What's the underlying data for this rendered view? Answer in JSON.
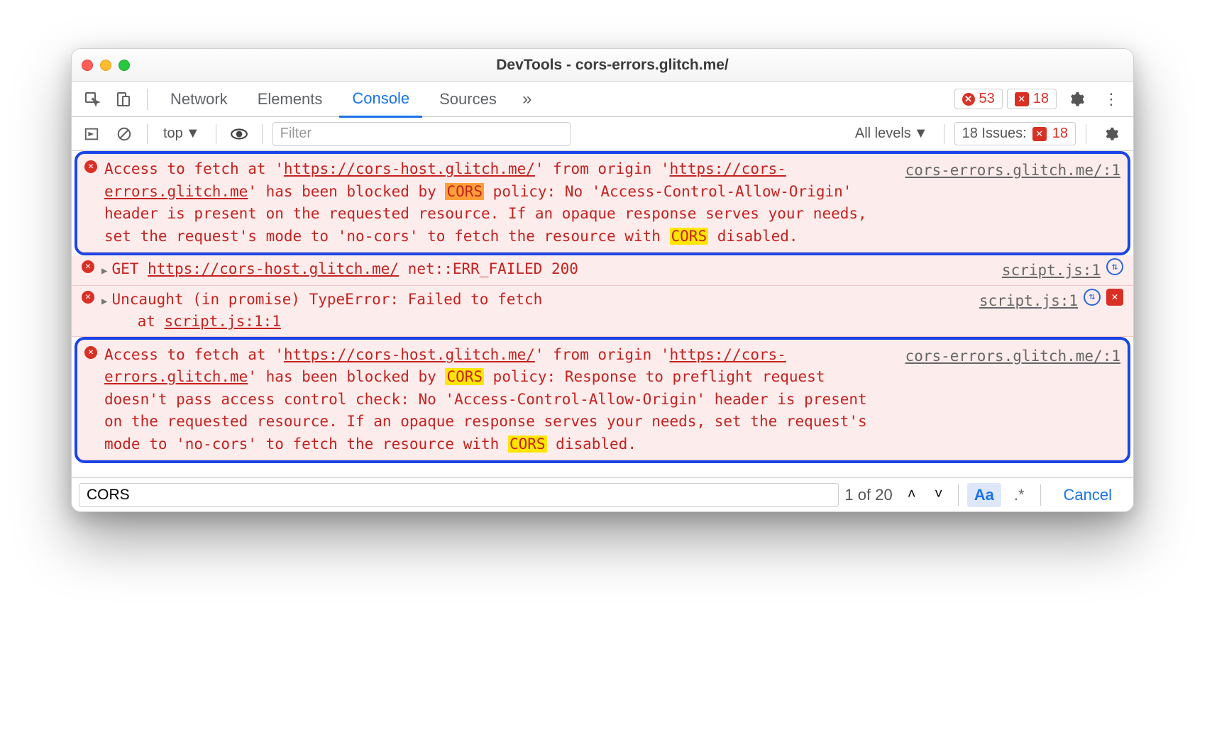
{
  "window": {
    "title": "DevTools - cors-errors.glitch.me/"
  },
  "tabs": {
    "items": [
      "Network",
      "Elements",
      "Console",
      "Sources"
    ],
    "active": "Console",
    "error_count": "53",
    "issue_count": "18"
  },
  "toolbar": {
    "context": "top",
    "filter_placeholder": "Filter",
    "levels": "All levels",
    "issues_label": "18 Issues:",
    "issues_count": "18"
  },
  "entries": [
    {
      "source": "cors-errors.glitch.me/:1",
      "parts": {
        "p1": "Access to fetch at '",
        "url1": "https://cors-host.glitch.me/",
        "p2": "' from origin '",
        "url2": "https://cors-errors.glitch.me",
        "p3": "' has been blocked by ",
        "cors1": "CORS",
        "p4": " policy: No 'Access-Control-Allow-Origin' header is present on the requested resource. If an opaque response serves your needs, set the request's mode to 'no-cors' to fetch the resource with ",
        "cors2": "CORS",
        "p5": " disabled."
      }
    },
    {
      "source": "script.js:1",
      "parts": {
        "p1": "GET ",
        "url1": "https://cors-host.glitch.me/",
        "p2": " net::ERR_FAILED 200"
      }
    },
    {
      "source": "script.js:1",
      "parts": {
        "p1": "Uncaught (in promise) TypeError: Failed to fetch",
        "p2": "    at ",
        "url1": "script.js:1:1"
      }
    },
    {
      "source": "cors-errors.glitch.me/:1",
      "parts": {
        "p1": "Access to fetch at '",
        "url1": "https://cors-host.glitch.me/",
        "p2": "' from origin '",
        "url2": "https://cors-errors.glitch.me",
        "p3": "' has been blocked by ",
        "cors1": "CORS",
        "p4": " policy: Response to preflight request doesn't pass access control check: No 'Access-Control-Allow-Origin' header is present on the requested resource. If an opaque response serves your needs, set the request's mode to 'no-cors' to fetch the resource with ",
        "cors2": "CORS",
        "p5": " disabled."
      }
    }
  ],
  "search": {
    "query": "CORS",
    "match": "1 of 20",
    "case_label": "Aa",
    "regex_label": ".*",
    "cancel": "Cancel"
  }
}
